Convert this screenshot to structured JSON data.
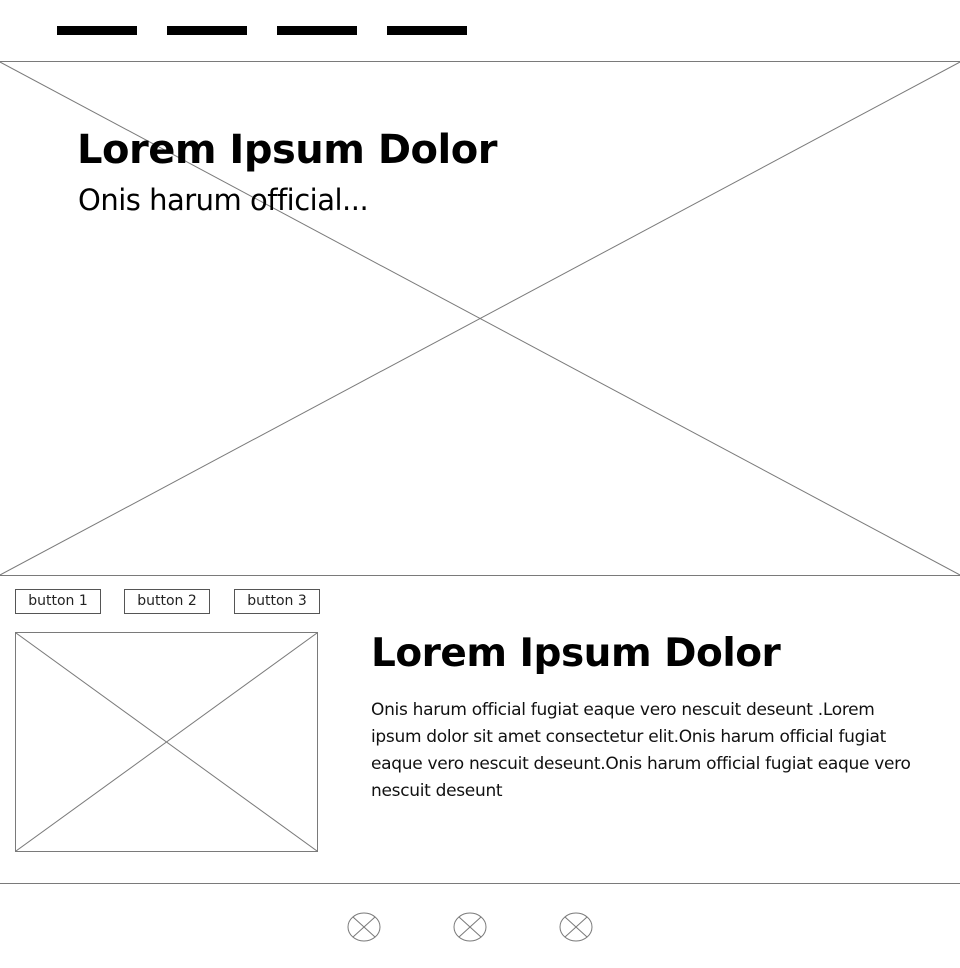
{
  "nav": {
    "items": [
      {
        "label": ""
      },
      {
        "label": ""
      },
      {
        "label": ""
      },
      {
        "label": ""
      }
    ]
  },
  "hero": {
    "title": "Lorem Ipsum Dolor",
    "subtitle": "Onis harum official..."
  },
  "buttons": [
    {
      "label": "button 1"
    },
    {
      "label": "button 2"
    },
    {
      "label": "button 3"
    }
  ],
  "content": {
    "title": "Lorem Ipsum Dolor",
    "body": "Onis harum official fugiat eaque vero nescuit deseunt .Lorem ipsum dolor sit amet consectetur elit.Onis harum official fugiat eaque vero nescuit deseunt.Onis harum official fugiat eaque vero nescuit deseunt"
  },
  "footer": {
    "icons": [
      "image-placeholder-icon",
      "image-placeholder-icon",
      "image-placeholder-icon"
    ]
  },
  "colors": {
    "line": "#7a7a7a",
    "nav_bar": "#000000",
    "background": "#ffffff"
  }
}
